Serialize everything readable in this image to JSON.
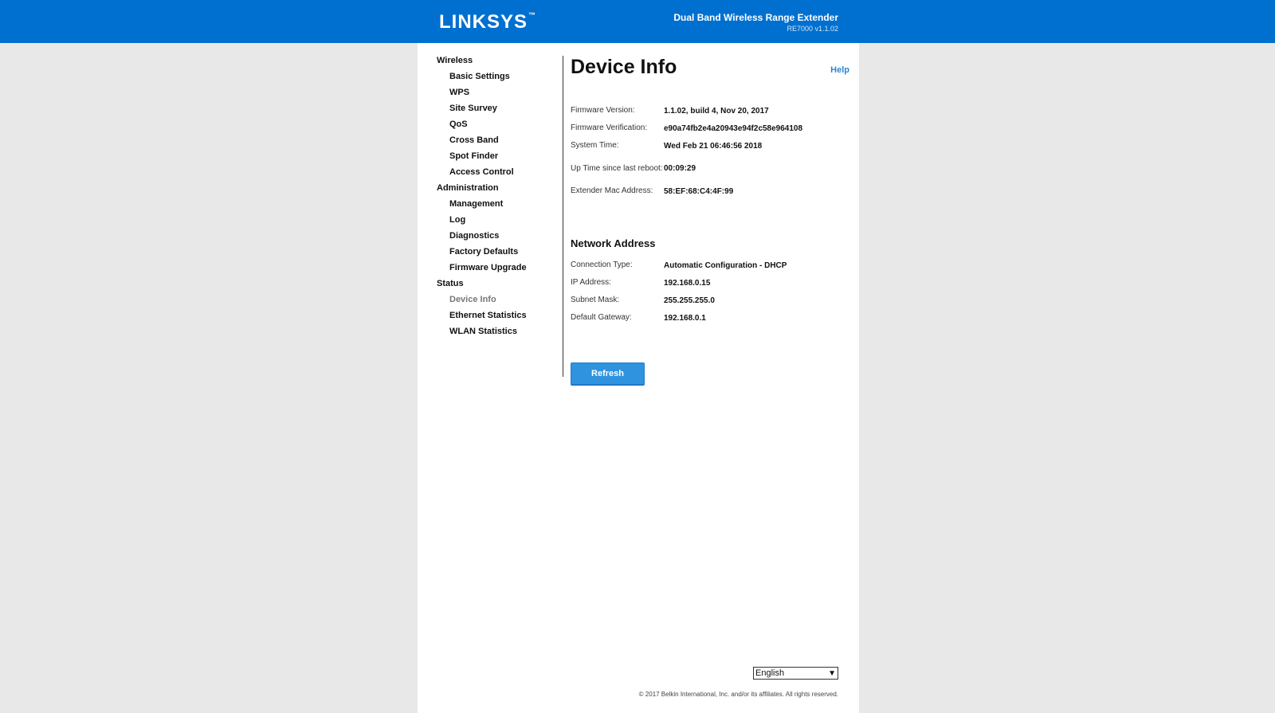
{
  "header": {
    "brand": "LINKSYS",
    "trademark": "™",
    "product_name": "Dual Band Wireless Range Extender",
    "model_version": "RE7000 v1.1.02",
    "background_color": "#0070d0"
  },
  "sidebar": [
    {
      "group": "Wireless",
      "items": [
        "Basic Settings",
        "WPS",
        "Site Survey",
        "QoS",
        "Cross Band",
        "Spot Finder",
        "Access Control"
      ]
    },
    {
      "group": "Administration",
      "items": [
        "Management",
        "Log",
        "Diagnostics",
        "Factory Defaults",
        "Firmware Upgrade"
      ]
    },
    {
      "group": "Status",
      "items": [
        "Device Info",
        "Ethernet Statistics",
        "WLAN Statistics"
      ]
    }
  ],
  "active_item": "Device Info",
  "page": {
    "title": "Device Info",
    "help_label": "Help"
  },
  "device_info": [
    {
      "label": "Firmware Version:",
      "value": "1.1.02, build 4, Nov 20, 2017"
    },
    {
      "label": "Firmware Verification:",
      "value": "e90a74fb2e4a20943e94f2c58e964108"
    },
    {
      "label": "System Time:",
      "value": "Wed Feb 21 06:46:56 2018"
    },
    {
      "label": "Up Time since last reboot:",
      "value": "00:09:29"
    },
    {
      "label": "Extender Mac Address:",
      "value": "58:EF:68:C4:4F:99"
    }
  ],
  "network": {
    "title": "Network Address",
    "rows": [
      {
        "label": "Connection Type:",
        "value": "Automatic Configuration - DHCP"
      },
      {
        "label": "IP Address:",
        "value": "192.168.0.15"
      },
      {
        "label": "Subnet Mask:",
        "value": "255.255.255.0"
      },
      {
        "label": "Default Gateway:",
        "value": "192.168.0.1"
      }
    ]
  },
  "refresh_label": "Refresh",
  "language": {
    "selected": "English"
  },
  "footer": {
    "copyright": "© 2017 Belkin International, Inc. and/or its affiliates. All rights reserved."
  }
}
